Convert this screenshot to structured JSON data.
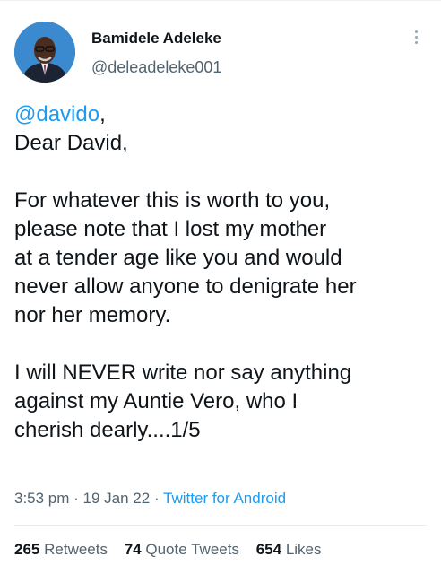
{
  "author": {
    "display_name": "Bamidele Adeleke",
    "handle": "@deleadeleke001"
  },
  "tweet": {
    "mention": "@davido",
    "mention_suffix": ",",
    "lines_paragraph1": [
      "Dear David,"
    ],
    "lines_paragraph2": [
      "For whatever this is worth to you,",
      "please note that I lost my mother",
      "at a tender age like you and would",
      "never allow anyone to denigrate her",
      "nor her memory."
    ],
    "lines_paragraph3": [
      "I will NEVER write nor say anything",
      "against my Auntie Vero, who I",
      "cherish dearly....1/5"
    ]
  },
  "meta": {
    "time": "3:53 pm",
    "separator": " · ",
    "date": "19 Jan 22",
    "source": "Twitter for Android"
  },
  "stats": {
    "retweets_count": "265",
    "retweets_label": "Retweets",
    "quotes_count": "74",
    "quotes_label": "Quote Tweets",
    "likes_count": "654",
    "likes_label": "Likes"
  },
  "colors": {
    "link": "#1d9bf0",
    "secondary_text": "#536471",
    "primary_text": "#0f1419"
  },
  "icons": {
    "more": "more-vertical-icon"
  }
}
